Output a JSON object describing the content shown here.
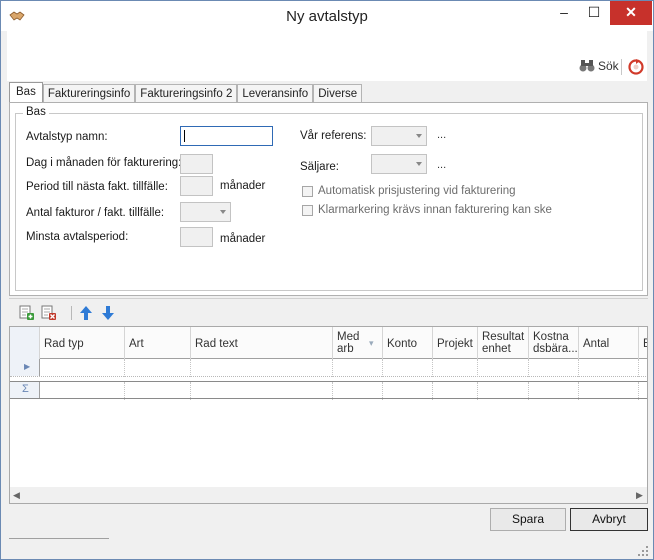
{
  "window": {
    "title": "Ny avtalstyp",
    "minimize": "–",
    "maximize": "☐",
    "close": "✕"
  },
  "toolbar": {
    "search_label": "Sök"
  },
  "tabs": [
    {
      "label": "Bas",
      "active": true
    },
    {
      "label": "Faktureringsinfo",
      "active": false
    },
    {
      "label": "Faktureringsinfo 2",
      "active": false
    },
    {
      "label": "Leveransinfo",
      "active": false
    },
    {
      "label": "Diverse",
      "active": false
    }
  ],
  "form": {
    "group_label": "Bas",
    "avtalstyp_namn": {
      "label": "Avtalstyp namn:",
      "value": ""
    },
    "dag_i_manaden": {
      "label": "Dag i månaden för fakturering:",
      "value": ""
    },
    "period": {
      "label": "Period till nästa fakt. tillfälle:",
      "value": "",
      "unit": "månader"
    },
    "antal_fakturor": {
      "label": "Antal fakturor / fakt. tillfälle:",
      "value": ""
    },
    "minsta_avtalsperiod": {
      "label": "Minsta avtalsperiod:",
      "value": "",
      "unit": "månader"
    },
    "var_referens": {
      "label": "Vår referens:",
      "value": "",
      "more": "..."
    },
    "saljare": {
      "label": "Säljare:",
      "value": "",
      "more": "..."
    },
    "auto_pris": {
      "label": "Automatisk prisjustering vid fakturering",
      "checked": false
    },
    "klarmarkering": {
      "label": "Klarmarkering krävs innan fakturering kan ske",
      "checked": false
    }
  },
  "grid": {
    "columns": [
      "Rad typ",
      "Art",
      "Rad text",
      "Med\narb",
      "Konto",
      "Projekt",
      "Resultat\nenhet",
      "Kostna\ndsbära...",
      "Antal",
      "E"
    ],
    "sum_symbol": "Σ",
    "row_indicator": "▶"
  },
  "buttons": {
    "save": "Spara",
    "cancel": "Avbryt"
  },
  "colors": {
    "close_bg": "#c7312b",
    "accent": "#2f6ab5",
    "add_icon": "#3a9a3a",
    "delete_icon": "#c0392b",
    "arrow_icon": "#2f7bd6"
  }
}
